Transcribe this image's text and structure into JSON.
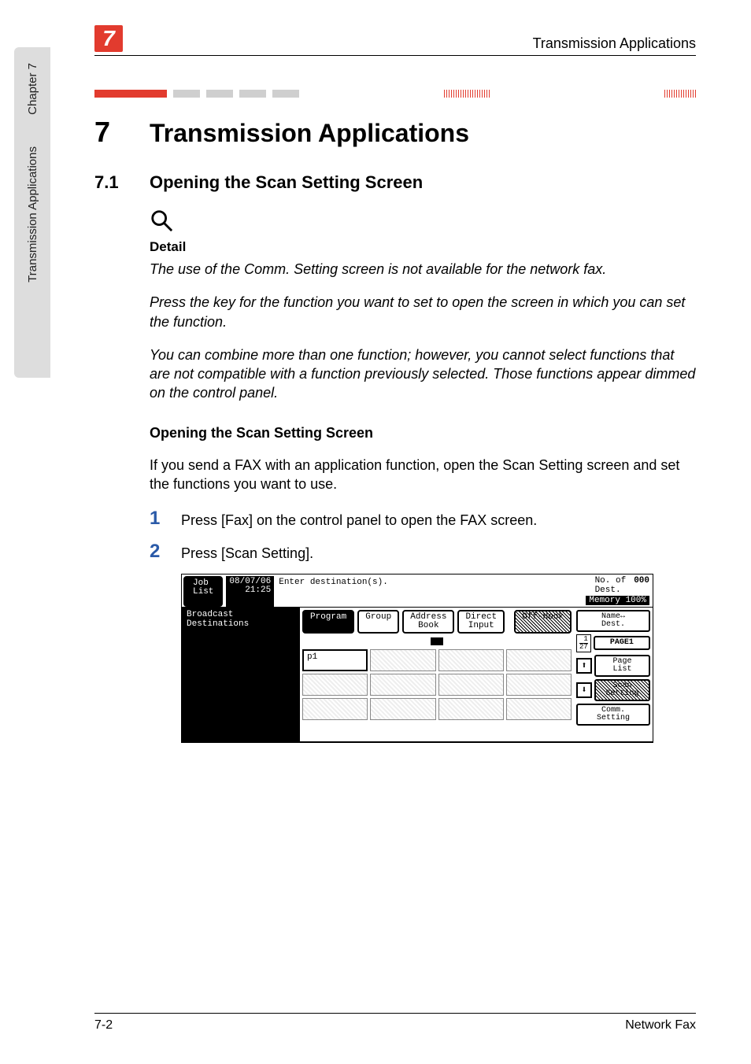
{
  "side_tab": {
    "chapter_label": "Chapter 7",
    "title": "Transmission Applications"
  },
  "running_header": {
    "badge": "7",
    "title": "Transmission Applications"
  },
  "chapter_heading": {
    "number": "7",
    "title": "Transmission Applications"
  },
  "section_heading": {
    "number": "7.1",
    "title": "Opening the Scan Setting Screen"
  },
  "detail": {
    "label": "Detail",
    "para1": "The use of the Comm. Setting screen is not available for the network fax.",
    "para2": "Press the key for the function you want to set to open the screen in which you can set the function.",
    "para3": "You can combine more than one function; however, you cannot select functions that are not compatible with a function previously selected. Those functions appear dimmed on the control panel."
  },
  "subheading": "Opening the Scan Setting Screen",
  "intro_para": "If you send a FAX with an application function, open the Scan Setting screen and set the functions you want to use.",
  "steps": [
    {
      "n": "1",
      "t": "Press [Fax] on the control panel to open the FAX screen."
    },
    {
      "n": "2",
      "t": "Press [Scan Setting]."
    }
  ],
  "fax_screen": {
    "job_list": "Job\nList",
    "date": "08/07/06",
    "time": "21:25",
    "top_message": "Enter destination(s).",
    "dest_label": "No. of\nDest.",
    "dest_count": "000",
    "memory_label": "Memory 100%",
    "left_text": "Broadcast\nDestinations",
    "tabs": {
      "program": "Program",
      "group": "Group",
      "address_book": "Address\nBook",
      "direct_input": "Direct\nInput",
      "off_hook": "Off-Hook"
    },
    "cell_p1": "p1",
    "right_buttons": {
      "name_dest": "Name↔\nDest.",
      "page1": "PAGE1",
      "page_list": "Page\nList",
      "scan_setting": "Scan\nSetting",
      "comm_setting": "Comm.\nSetting"
    },
    "page_count_top": "1",
    "page_count_bottom": "27",
    "arrow_up": "⬆",
    "arrow_down": "⬇"
  },
  "footer": {
    "left": "7-2",
    "right": "Network Fax"
  }
}
